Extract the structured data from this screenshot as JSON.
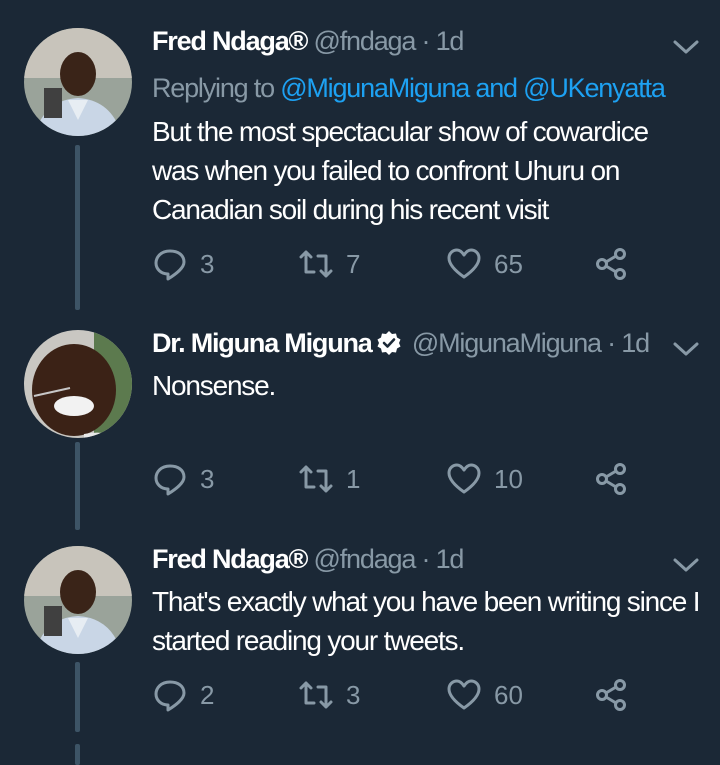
{
  "tweets": [
    {
      "name": "Fred Ndaga®",
      "handle": "@fndaga",
      "separator": "·",
      "time": "1d",
      "reply_prefix": "Replying to ",
      "reply_mentions": "@MigunaMiguna and @UKenyatta",
      "text": "But the most spectacular show of cowardice was when you failed to confront Uhuru on Canadian soil during his recent visit",
      "replies": "3",
      "retweets": "7",
      "likes": "65"
    },
    {
      "name": "Dr. Miguna Miguna",
      "handle": "@MigunaMiguna",
      "separator": "·",
      "time": "1d",
      "text": "Nonsense.",
      "replies": "3",
      "retweets": "1",
      "likes": "10"
    },
    {
      "name": "Fred Ndaga®",
      "handle": "@fndaga",
      "separator": "·",
      "time": "1d",
      "text": "That's exactly what you have been writing since I started reading your tweets.",
      "replies": "2",
      "retweets": "3",
      "likes": "60"
    }
  ],
  "colors": {
    "background": "#1b2836",
    "secondary_text": "#8899a6",
    "link": "#1da1f2",
    "thread_line": "#3d5466"
  }
}
